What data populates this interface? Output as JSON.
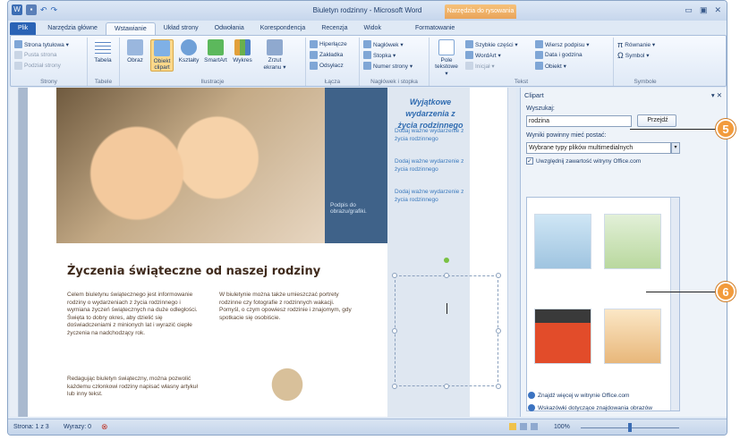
{
  "window": {
    "title": "Biuletyn rodzinny - Microsoft Word",
    "context_tab": "Narzędzia do rysowania"
  },
  "tabs": [
    "Plik",
    "Narzędzia główne",
    "Wstawianie",
    "Układ strony",
    "Odwołania",
    "Korespondencja",
    "Recenzja",
    "Widok",
    "Formatowanie"
  ],
  "ribbon": {
    "strony": {
      "label": "Strony",
      "items": [
        "Strona tytułowa ▾",
        "Pusta strona",
        "Podział strony"
      ]
    },
    "tabele": {
      "label": "Tabele",
      "items": [
        "Tabela"
      ]
    },
    "ilustracje": {
      "label": "Ilustracje",
      "items": [
        "Obraz",
        "Obiekt clipart",
        "Kształty",
        "SmartArt",
        "Wykres",
        "Zrzut ekranu ▾"
      ]
    },
    "lacza": {
      "label": "Łącza",
      "items": [
        "Hiperłącze",
        "Zakładka",
        "Odsyłacz"
      ]
    },
    "naglowek": {
      "label": "Nagłówek i stopka",
      "items": [
        "Nagłówek ▾",
        "Stopka ▾",
        "Numer strony ▾"
      ]
    },
    "tekst": {
      "label": "Tekst",
      "items": [
        "Pole tekstowe ▾",
        "Szybkie części ▾",
        "WordArt ▾",
        "Inicjał ▾",
        "Wiersz podpisu ▾",
        "Data i godzina",
        "Obiekt ▾"
      ]
    },
    "symbole": {
      "label": "Symbole",
      "items": [
        "Równanie ▾",
        "Symbol ▾"
      ]
    }
  },
  "document": {
    "photo_caption": "Podpis do obrazu/grafiki.",
    "sidebar_title": "Wyjątkowe wydarzenia z życia rodzinnego",
    "bullets": [
      "Dodaj ważne wydarzenie z życia rodzinnego",
      "Dodaj ważne wydarzenie z życia rodzinnego",
      "Dodaj ważne wydarzenie z życia rodzinnego"
    ],
    "heading": "Życzenia świąteczne od naszej rodziny",
    "col1_p1": "Celem biuletynu świątecznego jest informowanie rodziny o wydarzeniach z życia rodzinnego i wymiana życzeń świątecznych na duże odległości. Święta to dobry okres, aby dzielić się doświadczeniami z minionych lat i wyrazić ciepłe życzenia na nadchodzący rok.",
    "col1_p2": "Redagując biuletyn świąteczny, można pozwolić każdemu członkowi rodziny napisać własny artykuł lub inny tekst.",
    "col2_p1": "W biuletynie można także umieszczać portrety rodzinne czy fotografie z rodzinnych wakacji. Pomyśl, o czym opowiesz rodzinie i znajomym, gdy spotkacie się osobiście."
  },
  "clipart": {
    "title": "Clipart",
    "search_label": "Wyszukaj:",
    "search_value": "rodzina",
    "go_button": "Przejdź",
    "results_label": "Wyniki powinny mieć postać:",
    "results_value": "Wybrane typy plików multimedialnych",
    "office_checkbox": "Uwzględnij zawartość witryny Office.com",
    "link1": "Znajdź więcej w witrynie Office.com",
    "link2": "Wskazówki dotyczące znajdowania obrazów"
  },
  "status": {
    "page": "Strona: 1 z 3",
    "words": "Wyrazy: 0",
    "zoom": "100%"
  },
  "callouts": [
    "5",
    "6"
  ]
}
